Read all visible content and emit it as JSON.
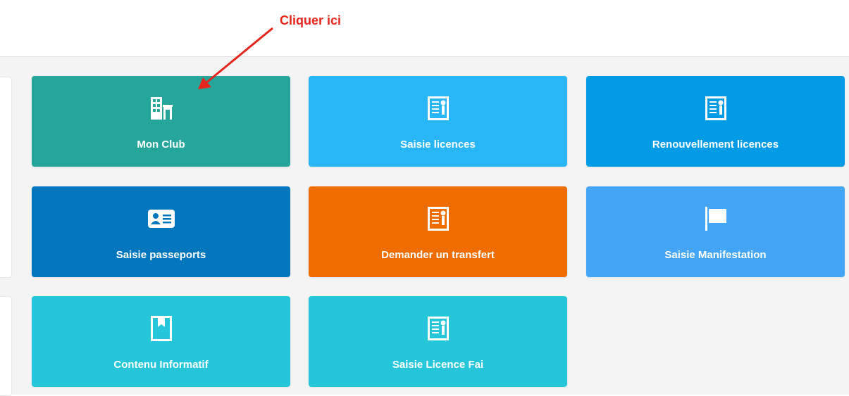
{
  "annotation": {
    "text": "Cliquer ici",
    "color": "#e5241b"
  },
  "tiles": [
    {
      "label": "Mon Club",
      "icon": "building-icon",
      "color": "#26a69a"
    },
    {
      "label": "Saisie licences",
      "icon": "certificate-icon",
      "color": "#29b6f6"
    },
    {
      "label": "Renouvellement licences",
      "icon": "certificate-icon",
      "color": "#039be5"
    },
    {
      "label": "Saisie passeports",
      "icon": "id-card-icon",
      "color": "#0277bd"
    },
    {
      "label": "Demander un transfert",
      "icon": "certificate-icon",
      "color": "#ef6c00"
    },
    {
      "label": "Saisie Manifestation",
      "icon": "flag-icon",
      "color": "#42a5f5"
    },
    {
      "label": "Contenu Informatif",
      "icon": "bookmark-icon",
      "color": "#26c6da"
    },
    {
      "label": "Saisie Licence Fai",
      "icon": "certificate-icon",
      "color": "#26c6da"
    }
  ]
}
